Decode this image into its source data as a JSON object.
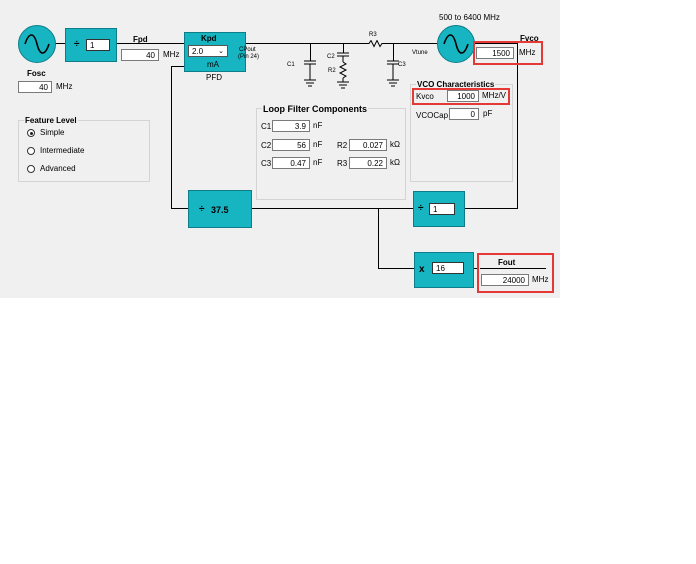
{
  "oscillator": {
    "label": "Fosc",
    "value": "40",
    "unit": "MHz",
    "icon": "sine-wave-icon"
  },
  "ref_divider": {
    "symbol": "÷",
    "value": "1"
  },
  "fpd": {
    "label": "Fpd",
    "value": "40",
    "unit": "MHz"
  },
  "pfd": {
    "kpd_label": "Kpd",
    "kpd_value": "2.0",
    "unit": "mA",
    "name": "PFD",
    "cpout": "CPout",
    "pin": "(Pin 24)"
  },
  "loop_components": {
    "c1": "C1",
    "c2": "C2",
    "r2": "R2",
    "r3": "R3",
    "c3": "C3",
    "vtune": "Vtune"
  },
  "vco": {
    "range": "500 to 6400 MHz",
    "fvco_label": "Fvco",
    "fvco_value": "1500",
    "fvco_unit": "MHz",
    "characteristics_title": "VCO Characteristics",
    "kvco_label": "Kvco",
    "kvco_value": "1000",
    "kvco_unit": "MHz/V",
    "vcocap_label": "VCOCap",
    "vcocap_value": "0",
    "vcocap_unit": "pF"
  },
  "feature_level": {
    "title": "Feature Level",
    "options": [
      "Simple",
      "Intermediate",
      "Advanced"
    ],
    "selected": "Simple"
  },
  "loop_filter": {
    "title": "Loop Filter Components",
    "c1": {
      "label": "C1",
      "value": "3.9",
      "unit": "nF"
    },
    "c2": {
      "label": "C2",
      "value": "56",
      "unit": "nF"
    },
    "c3": {
      "label": "C3",
      "value": "0.47",
      "unit": "nF"
    },
    "r2": {
      "label": "R2",
      "value": "0.027",
      "unit": "kΩ"
    },
    "r3": {
      "label": "R3",
      "value": "0.22",
      "unit": "kΩ"
    }
  },
  "n_divider": {
    "symbol": "÷",
    "value": "37.5"
  },
  "out_divider": {
    "symbol": "÷",
    "value": "1"
  },
  "multiplier": {
    "symbol": "x",
    "value": "16"
  },
  "fout": {
    "label": "Fout",
    "value": "24000",
    "unit": "MHz"
  },
  "colors": {
    "block": "#17b4c2",
    "highlight": "#e53935",
    "panel": "#f0f0f0"
  }
}
